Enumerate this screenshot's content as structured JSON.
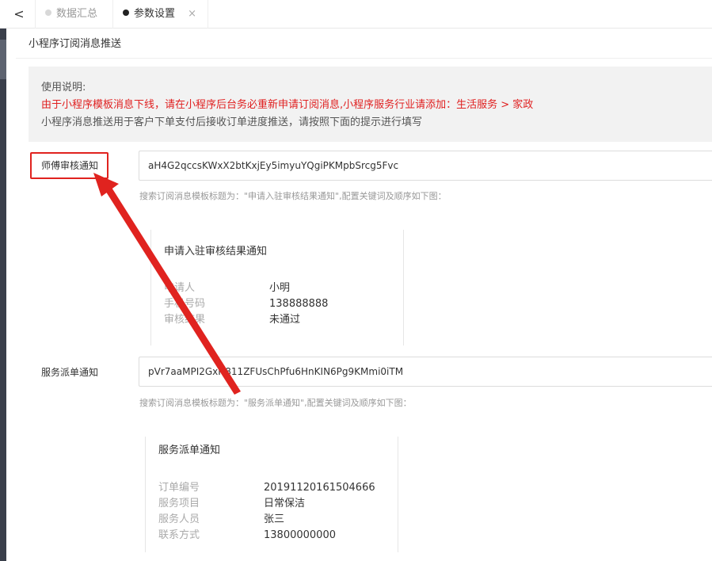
{
  "tabs": [
    {
      "label": "数据汇总",
      "active": false
    },
    {
      "label": "参数设置",
      "active": true
    }
  ],
  "tab_close_glyph": "×",
  "back_glyph": "<",
  "section_title": "小程序订阅消息推送",
  "notice": {
    "title": "使用说明:",
    "red_line": "由于小程序模板消息下线，请在小程序后台务必重新申请订阅消息,小程序服务行业请添加：生活服务 > 家政",
    "gray_line": "小程序消息推送用于客户下单支付后接收订单进度推送，请按照下面的提示进行填写"
  },
  "fields": [
    {
      "label": "师傅审核通知",
      "value": "aH4G2qccsKWxX2btKxjEy5imyuYQgiPKMpbSrcg5Fvc",
      "hint": "搜索订阅消息模板标题为：\"申请入驻审核结果通知\",配置关键词及顺序如下图：",
      "card": {
        "title": "申请入驻审核结果通知",
        "rows": [
          {
            "k": "申请人",
            "v": "小明"
          },
          {
            "k": "手机号码",
            "v": "138888888"
          },
          {
            "k": "审核结果",
            "v": "未通过"
          }
        ]
      }
    },
    {
      "label": "服务派单通知",
      "value": "pVr7aaMPI2GxH811ZFUsChPfu6HnKIN6Pg9KMmi0iTM",
      "hint": "搜索订阅消息模板标题为：\"服务派单通知\",配置关键词及顺序如下图：",
      "card": {
        "title": "服务派单通知",
        "rows": [
          {
            "k": "订单编号",
            "v": "20191120161504666"
          },
          {
            "k": "服务项目",
            "v": "日常保洁"
          },
          {
            "k": "服务人员",
            "v": "张三"
          },
          {
            "k": "联系方式",
            "v": "13800000000"
          }
        ]
      }
    }
  ],
  "colors": {
    "annotation_red": "#e0231f",
    "notice_red": "#e02020",
    "notice_bg": "#f2f2f2"
  }
}
